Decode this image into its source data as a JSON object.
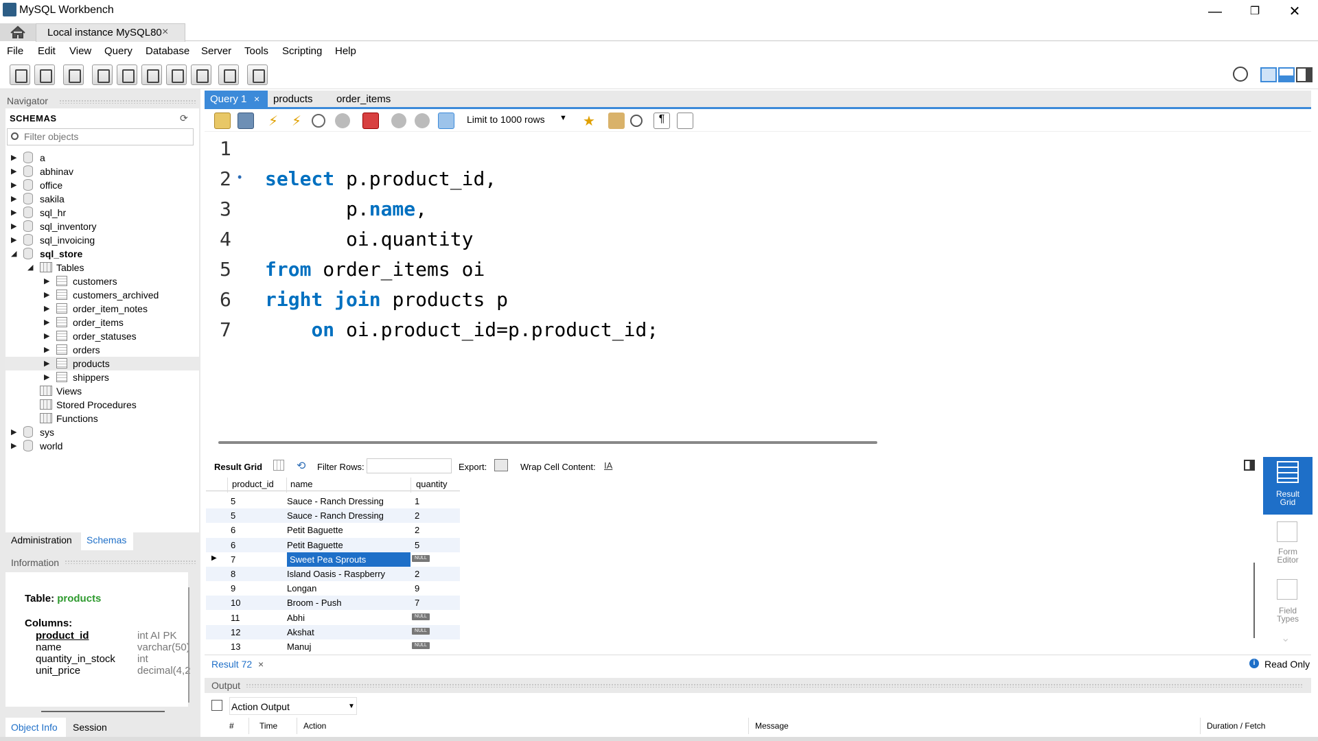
{
  "window": {
    "title": "MySQL Workbench",
    "minimize": "—",
    "restore": "❐",
    "close": "✕"
  },
  "instance_tab": {
    "label": "Local instance MySQL80",
    "close": "×"
  },
  "menu": [
    "File",
    "Edit",
    "View",
    "Query",
    "Database",
    "Server",
    "Tools",
    "Scripting",
    "Help"
  ],
  "navigator": {
    "header": "Navigator",
    "schemas_title": "SCHEMAS",
    "filter_placeholder": "Filter objects",
    "tree": [
      {
        "label": "a",
        "level": 0,
        "kind": "db",
        "arrow": "▶"
      },
      {
        "label": "abhinav",
        "level": 0,
        "kind": "db",
        "arrow": "▶"
      },
      {
        "label": "office",
        "level": 0,
        "kind": "db",
        "arrow": "▶"
      },
      {
        "label": "sakila",
        "level": 0,
        "kind": "db",
        "arrow": "▶"
      },
      {
        "label": "sql_hr",
        "level": 0,
        "kind": "db",
        "arrow": "▶"
      },
      {
        "label": "sql_inventory",
        "level": 0,
        "kind": "db",
        "arrow": "▶"
      },
      {
        "label": "sql_invoicing",
        "level": 0,
        "kind": "db",
        "arrow": "▶"
      },
      {
        "label": "sql_store",
        "level": 0,
        "kind": "db",
        "arrow": "◢",
        "bold": true
      },
      {
        "label": "Tables",
        "level": 1,
        "kind": "folder",
        "arrow": "◢"
      },
      {
        "label": "customers",
        "level": 2,
        "kind": "table",
        "arrow": "▶"
      },
      {
        "label": "customers_archived",
        "level": 2,
        "kind": "table",
        "arrow": "▶"
      },
      {
        "label": "order_item_notes",
        "level": 2,
        "kind": "table",
        "arrow": "▶"
      },
      {
        "label": "order_items",
        "level": 2,
        "kind": "table",
        "arrow": "▶"
      },
      {
        "label": "order_statuses",
        "level": 2,
        "kind": "table",
        "arrow": "▶"
      },
      {
        "label": "orders",
        "level": 2,
        "kind": "table",
        "arrow": "▶"
      },
      {
        "label": "products",
        "level": 2,
        "kind": "table",
        "arrow": "▶",
        "selected": true
      },
      {
        "label": "shippers",
        "level": 2,
        "kind": "table",
        "arrow": "▶"
      },
      {
        "label": "Views",
        "level": 1,
        "kind": "folder",
        "arrow": ""
      },
      {
        "label": "Stored Procedures",
        "level": 1,
        "kind": "folder",
        "arrow": ""
      },
      {
        "label": "Functions",
        "level": 1,
        "kind": "folder",
        "arrow": ""
      },
      {
        "label": "sys",
        "level": 0,
        "kind": "db",
        "arrow": "▶"
      },
      {
        "label": "world",
        "level": 0,
        "kind": "db",
        "arrow": "▶"
      }
    ],
    "tabs": {
      "administration": "Administration",
      "schemas": "Schemas"
    },
    "information_header": "Information",
    "info": {
      "table_prefix": "Table:",
      "table_name": "products",
      "columns_label": "Columns:",
      "columns": [
        {
          "name": "product_id",
          "type": "int AI PK"
        },
        {
          "name": "name",
          "type": "varchar(50)"
        },
        {
          "name": "quantity_in_stock",
          "type": "int"
        },
        {
          "name": "unit_price",
          "type": "decimal(4,2"
        }
      ]
    },
    "bottom_tabs": {
      "object_info": "Object Info",
      "session": "Session"
    }
  },
  "query_tabs": {
    "active": "Query 1",
    "active_close": "×",
    "others": [
      "products",
      "order_items"
    ]
  },
  "query_toolbar": {
    "limit": "Limit to 1000 rows",
    "limit_caret": "▼"
  },
  "editor": {
    "lines": [
      {
        "n": "1",
        "parts": []
      },
      {
        "n": "2",
        "marker": "•",
        "parts": [
          {
            "t": "select",
            "kw": true
          },
          {
            "t": " p.product_id,"
          }
        ]
      },
      {
        "n": "3",
        "parts": [
          {
            "t": "       p."
          },
          {
            "t": "name",
            "kw": true
          },
          {
            "t": ","
          }
        ]
      },
      {
        "n": "4",
        "parts": [
          {
            "t": "       oi.quantity"
          }
        ]
      },
      {
        "n": "5",
        "parts": [
          {
            "t": "from",
            "kw": true
          },
          {
            "t": " order_items oi"
          }
        ]
      },
      {
        "n": "6",
        "parts": [
          {
            "t": "right",
            "kw": true
          },
          {
            "t": " "
          },
          {
            "t": "join",
            "kw": true
          },
          {
            "t": " products p"
          }
        ]
      },
      {
        "n": "7",
        "parts": [
          {
            "t": "    "
          },
          {
            "t": "on",
            "kw": true
          },
          {
            "t": " oi.product_id=p.product_id;"
          }
        ]
      }
    ]
  },
  "result_toolbar": {
    "result_grid": "Result Grid",
    "filter_rows": "Filter Rows:",
    "export": "Export:",
    "wrap": "Wrap Cell Content:"
  },
  "grid": {
    "columns": [
      "product_id",
      "name",
      "quantity"
    ],
    "null_text": "NULL",
    "rows": [
      {
        "id": "5",
        "name": "Sauce - Ranch Dressing",
        "qty": "1"
      },
      {
        "id": "5",
        "name": "Sauce - Ranch Dressing",
        "qty": "2"
      },
      {
        "id": "6",
        "name": "Petit Baguette",
        "qty": "2"
      },
      {
        "id": "6",
        "name": "Petit Baguette",
        "qty": "5"
      },
      {
        "id": "7",
        "name": "Sweet Pea Sprouts",
        "qty": null,
        "current": true
      },
      {
        "id": "8",
        "name": "Island Oasis - Raspberry",
        "qty": "2"
      },
      {
        "id": "9",
        "name": "Longan",
        "qty": "9"
      },
      {
        "id": "10",
        "name": "Broom - Push",
        "qty": "7"
      },
      {
        "id": "11",
        "name": "Abhi",
        "qty": null
      },
      {
        "id": "12",
        "name": "Akshat",
        "qty": null
      },
      {
        "id": "13",
        "name": "Manuj",
        "qty": null
      }
    ]
  },
  "side_panel": {
    "result_grid": "Result\nGrid",
    "form_editor": "Form\nEditor",
    "field_types": "Field\nTypes",
    "read_only": "Read Only"
  },
  "result_tab": {
    "label": "Result 72",
    "close": "×"
  },
  "output": {
    "header": "Output",
    "selector": "Action Output",
    "columns": {
      "hash": "#",
      "time": "Time",
      "action": "Action",
      "message": "Message",
      "duration": "Duration / Fetch"
    }
  },
  "colors": {
    "accent": "#3c8ad9",
    "keyword": "#0070c0",
    "selected_cell": "#1e6fc8",
    "info_green": "#2e9a2e"
  }
}
